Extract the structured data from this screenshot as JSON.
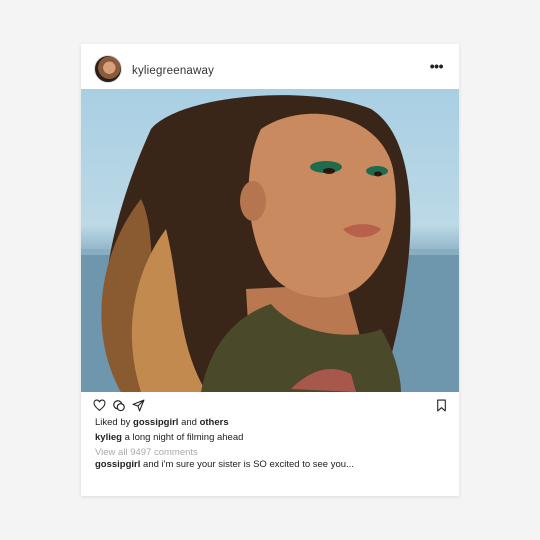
{
  "post": {
    "username": "kyliegreenaway",
    "more_icon": "more-dots-icon",
    "liked_prefix": "Liked by",
    "liked_user": "gossipgirl",
    "liked_and": "and",
    "liked_others": "others",
    "caption_user": "kylieg",
    "caption_text": "a long night of filming ahead",
    "view_comments": "View all 9497 comments",
    "comment_user": "gossipgirl",
    "comment_text": "and i'm sure your sister is SO excited to see you..."
  },
  "icons": {
    "like": "heart-icon",
    "comment": "comment-icon",
    "share": "send-icon",
    "save": "bookmark-icon"
  },
  "colors": {
    "background": "#f4f4f4",
    "card": "#ffffff",
    "text": "#222222",
    "muted": "#aaaaaa"
  }
}
